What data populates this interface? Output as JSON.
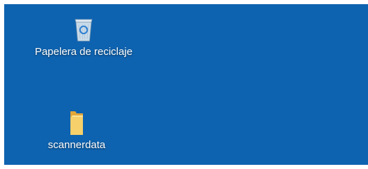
{
  "desktop": {
    "background_color": "#0e63b0",
    "icons": [
      {
        "label": "Papelera de reciclaje",
        "icon": "recycle-bin-icon"
      },
      {
        "label": "scannerdata",
        "icon": "folder-icon"
      }
    ]
  }
}
